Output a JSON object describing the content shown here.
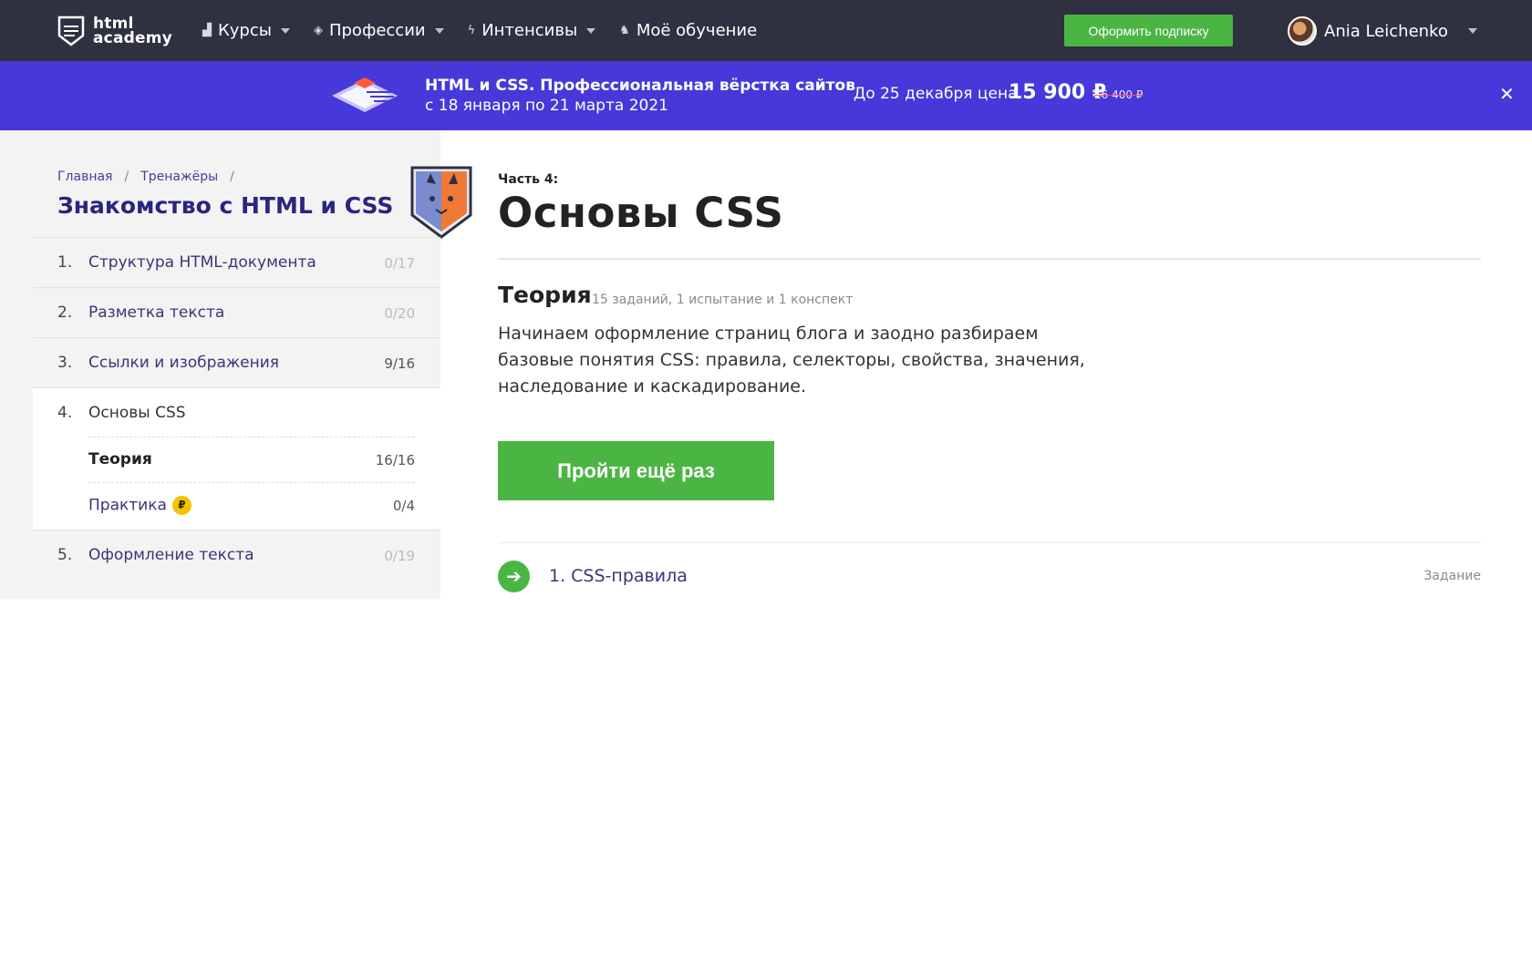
{
  "header": {
    "logo_text_1": "html",
    "logo_text_2": "academy",
    "nav": [
      {
        "label": "Курсы",
        "icon": "bars-chart-icon"
      },
      {
        "label": "Профессии",
        "icon": "graduation-cap-icon"
      },
      {
        "label": "Интенсивы",
        "icon": "lightning-icon"
      },
      {
        "label": "Моё обучение",
        "icon": "cats-icon"
      }
    ],
    "subscribe_label": "Оформить подписку",
    "user_name": "Ania Leichenko"
  },
  "promo": {
    "title": "HTML и CSS. Профессиональная вёрстка сайтов",
    "dates": "с 18 января по 21 марта 2021",
    "price_text": "До 25 декабря цена",
    "price_now": "15 900 ₽",
    "price_old": "16 400 ₽",
    "close_symbol": "✕"
  },
  "sidebar": {
    "breadcrumb": [
      "Главная",
      "Тренажёры"
    ],
    "breadcrumb_sep": "/",
    "course_title": "Знакомство с HTML и CSS",
    "chapters": [
      {
        "num": "1.",
        "name": "Структура HTML-документа",
        "count": "0/17"
      },
      {
        "num": "2.",
        "name": "Разметка текста",
        "count": "0/20"
      },
      {
        "num": "3.",
        "name": "Ссылки и изображения",
        "count": "9/16"
      },
      {
        "num": "4.",
        "name": "Основы CSS",
        "count": ""
      },
      {
        "num": "5.",
        "name": "Оформление текста",
        "count": "0/19"
      }
    ],
    "subitems": [
      {
        "label": "Теория",
        "count": "16/16"
      },
      {
        "label": "Практика",
        "count": "0/4",
        "coin": "₽"
      }
    ]
  },
  "main": {
    "part_label": "Часть 4:",
    "title": "Основы CSS",
    "theory_title": "Теория",
    "theory_meta": "15 заданий, 1 испытание и 1 конспект",
    "theory_desc": "Начинаем оформление страниц блога и заодно разбираем базовые понятия CSS: правила, селекторы, свойства, значения, наследование и каскадирование.",
    "cta_label": "Пройти ещё раз",
    "task": {
      "name": "1. CSS-правила",
      "type": "Задание",
      "arrow": "➔"
    }
  },
  "colors": {
    "header_bg": "#2f3040",
    "promo_bg": "#4638d9",
    "accent_green": "#4bb544",
    "link_purple": "#2a2580"
  }
}
